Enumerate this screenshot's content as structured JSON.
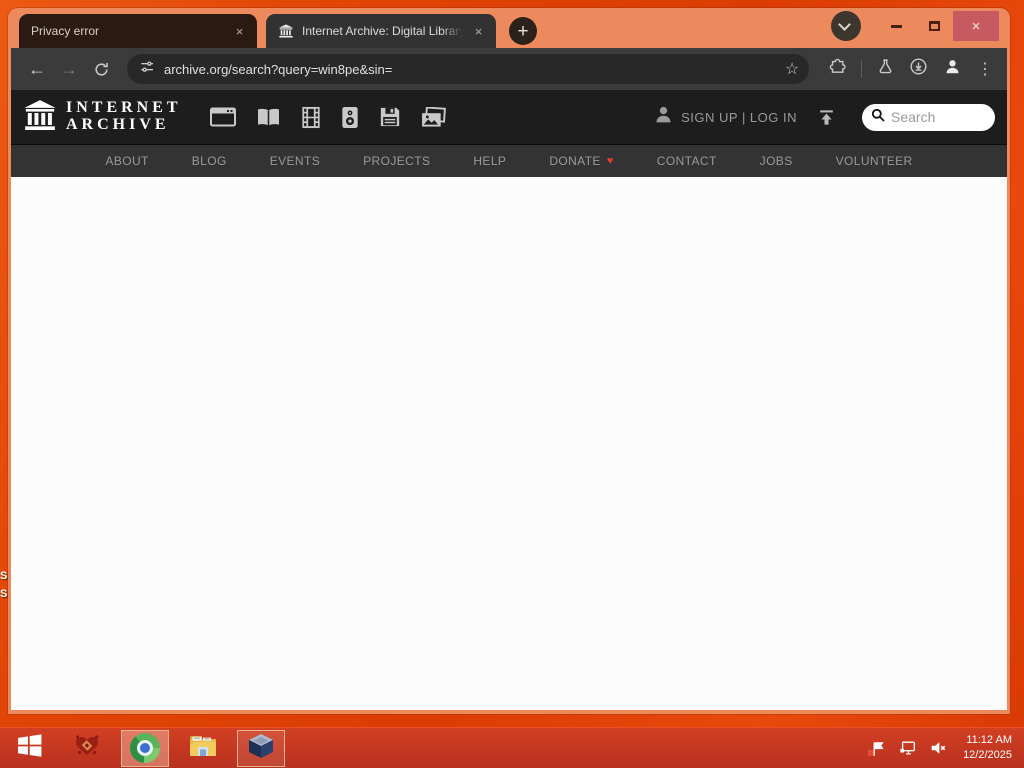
{
  "browser": {
    "tab1": {
      "title": "Privacy error"
    },
    "tab2": {
      "title": "Internet Archive: Digital Library"
    },
    "url": "archive.org/search?query=win8pe&sin="
  },
  "glyphs": {
    "close": "×",
    "new_tab": "+",
    "back": "←",
    "forward": "→",
    "star": "☆",
    "kebab": "⋮",
    "donate_heart": "♥"
  },
  "ia": {
    "wordmark_line1": "INTERNET",
    "wordmark_line2": "ARCHIVE",
    "auth": "SIGN UP | LOG IN",
    "search_placeholder": "Search",
    "nav": {
      "about": "ABOUT",
      "blog": "BLOG",
      "events": "EVENTS",
      "projects": "PROJECTS",
      "help": "HELP",
      "donate": "DONATE",
      "contact": "CONTACT",
      "jobs": "JOBS",
      "volunteer": "VOLUNTEER"
    }
  },
  "desktop": {
    "icon_label_fragment1": "S",
    "icon_label_fragment2": "S"
  },
  "taskbar": {
    "time": "11:12 AM",
    "date": "12/2/2025"
  },
  "colors": {
    "frame": "#ec8a5e",
    "desktop_accent": "#e04505",
    "taskbar": "#c23620",
    "donate_heart": "#e03a2f"
  }
}
